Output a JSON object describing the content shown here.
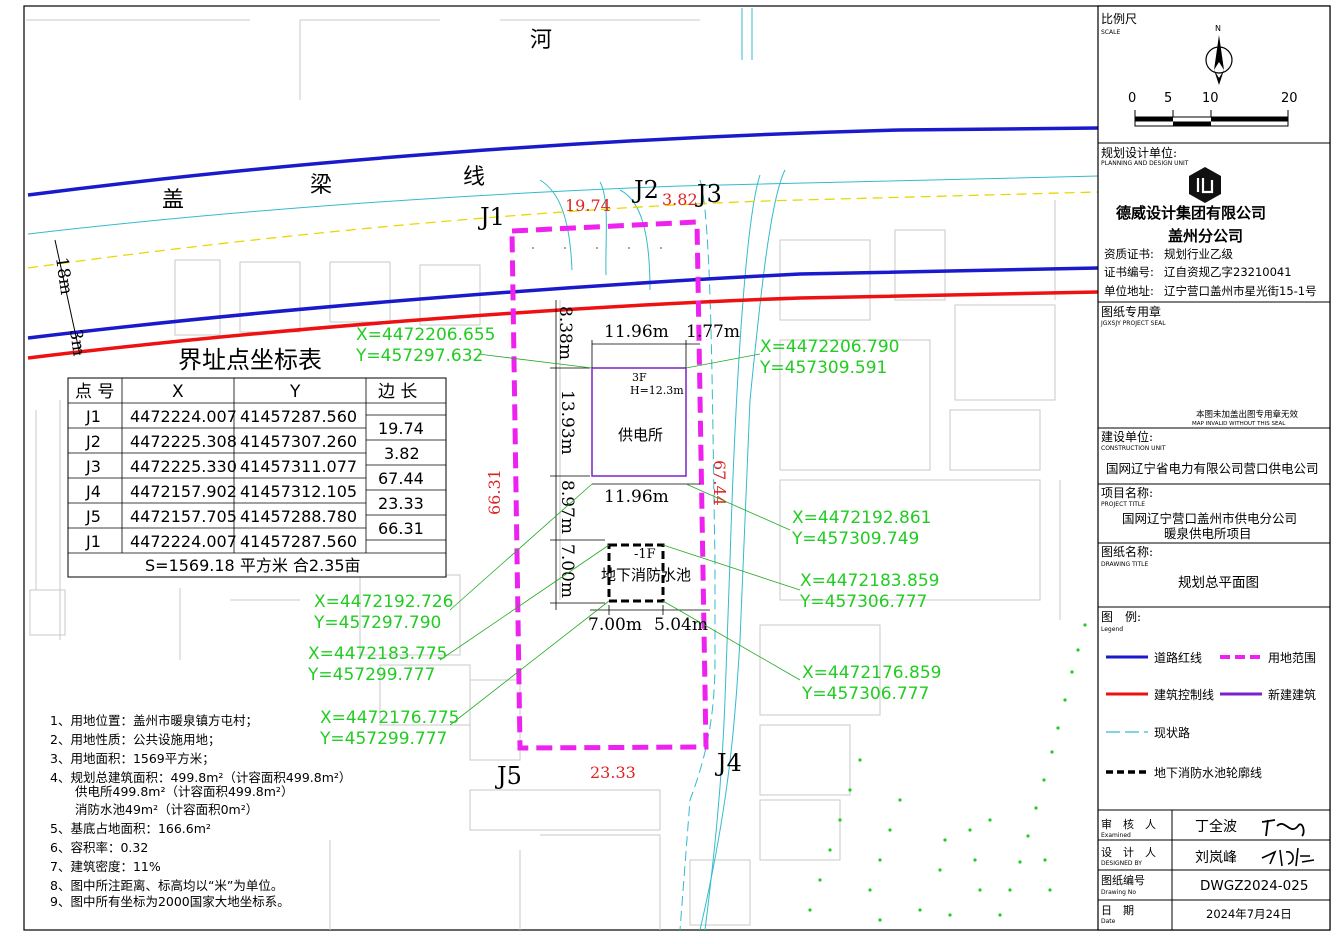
{
  "map": {
    "river": "河",
    "road_chars": [
      "盖",
      "梁",
      "线"
    ],
    "road_width_18": "18m",
    "road_width_3": "3m",
    "building_label": "供电所",
    "building_floors": "3F",
    "building_height": "H=12.3m",
    "pool_floor": "-1F",
    "pool_label": "地下消防水池",
    "points": {
      "j1": "J1",
      "j2": "J2",
      "j3": "J3",
      "j4": "J4",
      "j5": "J5"
    },
    "edge_lengths": {
      "j1_j2": "19.74",
      "j2_j3": "3.82",
      "j3_j4": "67.44",
      "j4_j5": "23.33",
      "j5_j1": "66.31"
    },
    "dimensions": {
      "d_838": "8.38m",
      "d_1196a": "11.96m",
      "d_177": "1.77m",
      "d_1393": "13.93m",
      "d_1196b": "11.96m",
      "d_897": "8.97m",
      "d_700v": "7.00m",
      "d_700h": "7.00m",
      "d_504": "5.04m"
    },
    "coords": [
      {
        "x": "X=4472206.655",
        "y": "Y=457297.632"
      },
      {
        "x": "X=4472206.790",
        "y": "Y=457309.591"
      },
      {
        "x": "X=4472192.861",
        "y": "Y=457309.749"
      },
      {
        "x": "X=4472183.859",
        "y": "Y=457306.777"
      },
      {
        "x": "X=4472176.859",
        "y": "Y=457306.777"
      },
      {
        "x": "X=4472192.726",
        "y": "Y=457297.790"
      },
      {
        "x": "X=4472183.775",
        "y": "Y=457299.777"
      },
      {
        "x": "X=4472176.775",
        "y": "Y=457299.777"
      }
    ],
    "colors": {
      "road_red_line": "#1a1acc",
      "build_control": "#ee1111",
      "site": "#ee22ee",
      "new_building": "#7a22cc",
      "existing_road": "#33bbcc",
      "coord_text": "#22cc22",
      "edge_text": "#dd2222",
      "plot_outline": "#c9c9c9"
    }
  },
  "coord_table": {
    "title": "界址点坐标表",
    "headers": [
      "点 号",
      "X",
      "Y",
      "边 长"
    ],
    "rows": [
      {
        "pt": "J1",
        "x": "4472224.007",
        "y": "41457287.560"
      },
      {
        "pt": "J2",
        "x": "4472225.308",
        "y": "41457307.260"
      },
      {
        "pt": "J3",
        "x": "4472225.330",
        "y": "41457311.077"
      },
      {
        "pt": "J4",
        "x": "4472157.902",
        "y": "41457312.105"
      },
      {
        "pt": "J5",
        "x": "4472157.705",
        "y": "41457288.780"
      },
      {
        "pt": "J1",
        "x": "4472224.007",
        "y": "41457287.560"
      }
    ],
    "edges": [
      "19.74",
      "3.82",
      "67.44",
      "23.33",
      "66.31"
    ],
    "area": "S=1569.18 平方米 合2.35亩"
  },
  "notes": [
    "1、用地位置：盖州市暖泉镇方屯村；",
    "2、用地性质：公共设施用地；",
    "3、用地面积：1569平方米；",
    "4、规划总建筑面积：499.8m²（计容面积499.8m²）",
    "　　供电所499.8m²（计容面积499.8m²）",
    "　　消防水池49m²（计容面积0m²）",
    "5、基底占地面积：166.6m²",
    "6、容积率：0.32",
    "7、建筑密度：11%",
    "8、图中所注距离、标高均以“米”为单位。",
    "9、图中所有坐标为2000国家大地坐标系。"
  ],
  "title_block": {
    "scale_label": "比例尺",
    "scale_label_en": "SCALE",
    "north": "N",
    "scale_ticks": [
      "0",
      "5",
      "10",
      "20"
    ],
    "unit_label": "规划设计单位:",
    "unit_label_en": "PLANNING AND DESIGN UNIT",
    "company_line1": "德威设计集团有限公司",
    "company_line2": "盖州分公司",
    "qual_label": "资质证书:",
    "qual_value": "规划行业乙级",
    "cert_label": "证书编号:",
    "cert_value": "辽自资规乙字23210041",
    "addr_label": "单位地址:",
    "addr_value": "辽宁营口盖州市星光街15-1号",
    "seal_label": "图纸专用章",
    "seal_label_en": "JGXSJY PROJECT SEAL",
    "seal_note": "本图未加盖出图专用章无效",
    "seal_note_en": "MAP INVALID WITHOUT THIS SEAL",
    "construction_label": "建设单位:",
    "construction_label_en": "CONSTRUCTION UNIT",
    "construction_value": "国网辽宁省电力有限公司营口供电公司",
    "project_label": "项目名称:",
    "project_label_en": "PROJECT TITLE",
    "project_line1": "国网辽宁营口盖州市供电分公司",
    "project_line2": "暖泉供电所项目",
    "drawing_label": "图纸名称:",
    "drawing_label_en": "DRAWING TITLE",
    "drawing_value": "规划总平面图",
    "legend_label": "图　例:",
    "legend_label_en": "Legend",
    "legend": {
      "road_red_line": "道路红线",
      "site_boundary": "用地范围",
      "build_control": "建筑控制线",
      "new_building": "新建建筑",
      "existing_road": "现状路",
      "pool_outline": "地下消防水池轮廓线"
    },
    "review_label": "审　核　人",
    "review_label_en": "Examined",
    "review_value": "丁全波",
    "design_label": "设　计　人",
    "design_label_en": "DESIGNED BY",
    "design_value": "刘岚峰",
    "drawing_no_label": "图纸编号",
    "drawing_no_label_en": "Drawing No",
    "drawing_no_value": "DWGZ2024-025",
    "date_label": "日　期",
    "date_label_en": "Date",
    "date_value": "2024年7月24日"
  }
}
